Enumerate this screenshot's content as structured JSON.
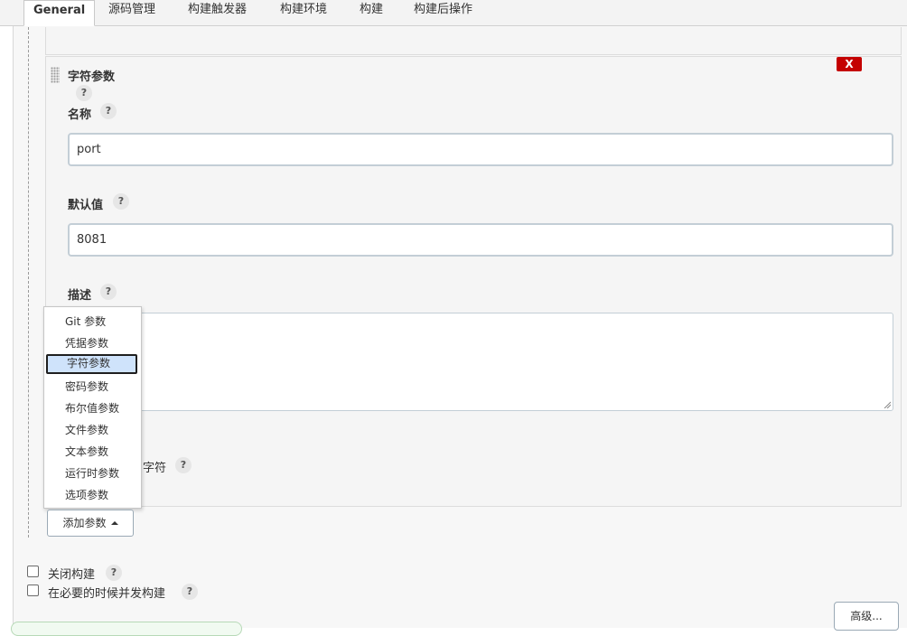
{
  "tabs": [
    "General",
    "源码管理",
    "构建触发器",
    "构建环境",
    "构建",
    "构建后操作"
  ],
  "param": {
    "title": "字符参数",
    "delete_label": "X",
    "help": "?",
    "name_label": "名称",
    "name_value": "port",
    "default_label": "默认值",
    "default_value": "8081",
    "desc_label": "描述",
    "desc_value": "",
    "trim_label_visible": "字符"
  },
  "param_menu": {
    "items": [
      "Git 参数",
      "凭据参数",
      "字符参数",
      "密码参数",
      "布尔值参数",
      "文件参数",
      "文本参数",
      "运行时参数",
      "选项参数"
    ],
    "selected": "字符参数"
  },
  "add_param_label": "添加参数",
  "options": {
    "disable_build": {
      "label": "关闭构建",
      "checked": false
    },
    "concurrent_build": {
      "label": "在必要的时候并发构建",
      "checked": false
    }
  },
  "advanced_label": "高级...",
  "colors": {
    "delete": "#c40000",
    "menu_selected": "#cfe3fb",
    "input_border": "#c3ced6"
  }
}
